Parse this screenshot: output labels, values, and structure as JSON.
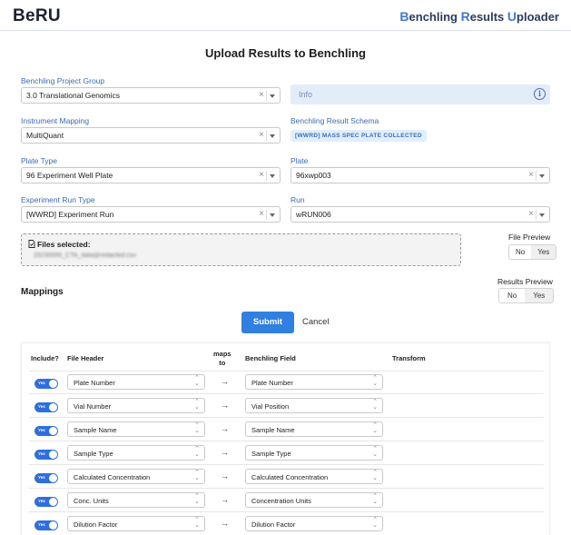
{
  "header": {
    "logo": "BeRU",
    "tagline": [
      {
        "cap": "B",
        "rest": "enchling "
      },
      {
        "cap": "R",
        "rest": "esults "
      },
      {
        "cap": "U",
        "rest": "ploader"
      }
    ]
  },
  "page_title": "Upload Results to Benchling",
  "form": {
    "project_group": {
      "label": "Benchling Project Group",
      "value": "3.0 Translational Genomics"
    },
    "info": {
      "text": "Info",
      "icon": "info-icon"
    },
    "instrument_mapping": {
      "label": "Instrument Mapping",
      "value": "MultiQuant"
    },
    "result_schema": {
      "label": "Benchling Result Schema",
      "value": "[WWRD] MASS SPEC PLATE COLLECTED"
    },
    "plate_type": {
      "label": "Plate Type",
      "value": "96 Experiment Well Plate"
    },
    "plate": {
      "label": "Plate",
      "value": "96xwp003"
    },
    "experiment_run_type": {
      "label": "Experiment Run Type",
      "value": "[WWRD] Experiment Run"
    },
    "run": {
      "label": "Run",
      "value": "wRUN006"
    },
    "clear_symbol": "×"
  },
  "files": {
    "title": "Files selected:",
    "icon": "file-icon",
    "filename": "20230000_CTA_data@redacted.csv"
  },
  "file_preview": {
    "label": "File Preview",
    "no": "No",
    "yes": "Yes"
  },
  "results_preview": {
    "label": "Results Preview",
    "no": "No",
    "yes": "Yes"
  },
  "mappings_title": "Mappings",
  "actions": {
    "submit": "Submit",
    "cancel": "Cancel"
  },
  "table": {
    "headers": {
      "include": "Include?",
      "file_header": "File Header",
      "maps_to_1": "maps",
      "maps_to_2": "to",
      "benchling_field": "Benchling Field",
      "transform": "Transform"
    },
    "toggle_label": "Yes",
    "arrow": "→",
    "rows": [
      {
        "file_header": "Plate Number",
        "benchling_field": "Plate Number"
      },
      {
        "file_header": "Vial Number",
        "benchling_field": "Vial Position"
      },
      {
        "file_header": "Sample Name",
        "benchling_field": "Sample Name"
      },
      {
        "file_header": "Sample Type",
        "benchling_field": "Sample Type"
      },
      {
        "file_header": "Calculated Concentration",
        "benchling_field": "Calculated Concentration"
      },
      {
        "file_header": "Conc. Units",
        "benchling_field": "Concentration Units"
      },
      {
        "file_header": "Dilution Factor",
        "benchling_field": "Dilution Factor"
      }
    ]
  },
  "colors": {
    "accent": "#2f80e0",
    "label": "#3b69b3",
    "toggle": "#2f6fdc"
  }
}
